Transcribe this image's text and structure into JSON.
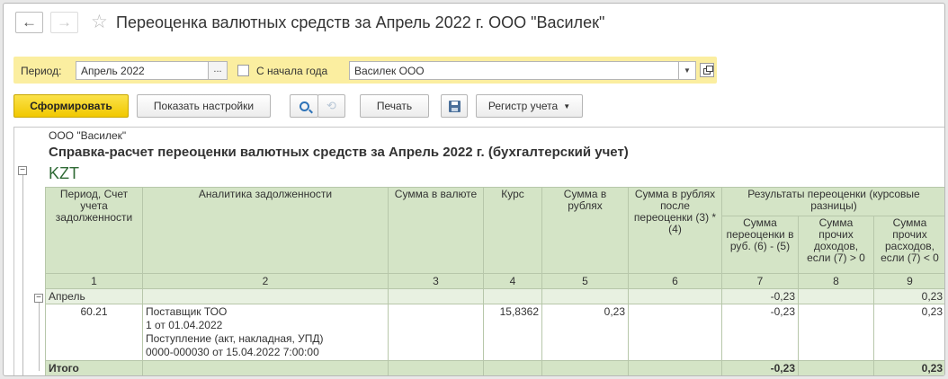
{
  "window": {
    "title": "Переоценка валютных средств за Апрель 2022 г. ООО \"Василек\""
  },
  "nav": {
    "back_icon": "←",
    "forward_icon": "→",
    "favorite_icon": "☆"
  },
  "filters": {
    "period_label": "Период:",
    "period_value": "Апрель 2022",
    "period_select_label": "...",
    "from_year_start_label": "С начала года",
    "from_year_start_checked": false,
    "organization_value": "Василек ООО"
  },
  "toolbar": {
    "generate_label": "Сформировать",
    "settings_label": "Показать настройки",
    "print_label": "Печать",
    "register_label": "Регистр учета"
  },
  "report": {
    "organization": "ООО \"Василек\"",
    "title": "Справка-расчет переоценки валютных средств за Апрель 2022 г. (бухгалтерский учет)",
    "currency": "KZT",
    "headers": {
      "col1": "Период, Счет учета задолженности",
      "col2": "Аналитика задолженности",
      "col3": "Сумма в валюте",
      "col4": "Курс",
      "col5": "Сумма в рублях",
      "col6": "Сумма в рублях после переоценки (3) * (4)",
      "group": "Результаты переоценки (курсовые разницы)",
      "col7": "Сумма переоценки в руб. (6) - (5)",
      "col8": "Сумма прочих доходов, если (7) > 0",
      "col9": "Сумма прочих расходов, если (7) < 0"
    },
    "col_numbers": [
      "1",
      "2",
      "3",
      "4",
      "5",
      "6",
      "7",
      "8",
      "9"
    ],
    "group_row": {
      "label": "Апрель",
      "col7": "-0,23",
      "col9": "0,23"
    },
    "detail_row": {
      "account": "60.21",
      "analytics": [
        "Поставщик ТОО",
        "1 от 01.04.2022",
        "Поступление (акт, накладная, УПД)",
        "0000-000030 от 15.04.2022 7:00:00"
      ],
      "rate": "15,8362",
      "sum_rub": "0,23",
      "col7": "-0,23",
      "col9": "0,23"
    },
    "total_row": {
      "label": "Итого",
      "col7": "-0,23",
      "col9": "0,23"
    }
  },
  "colors": {
    "primary_button": "#f5d21a",
    "filter_bar": "#fbeea0",
    "table_header": "#d4e4c6",
    "currency_text": "#2f6a35"
  }
}
